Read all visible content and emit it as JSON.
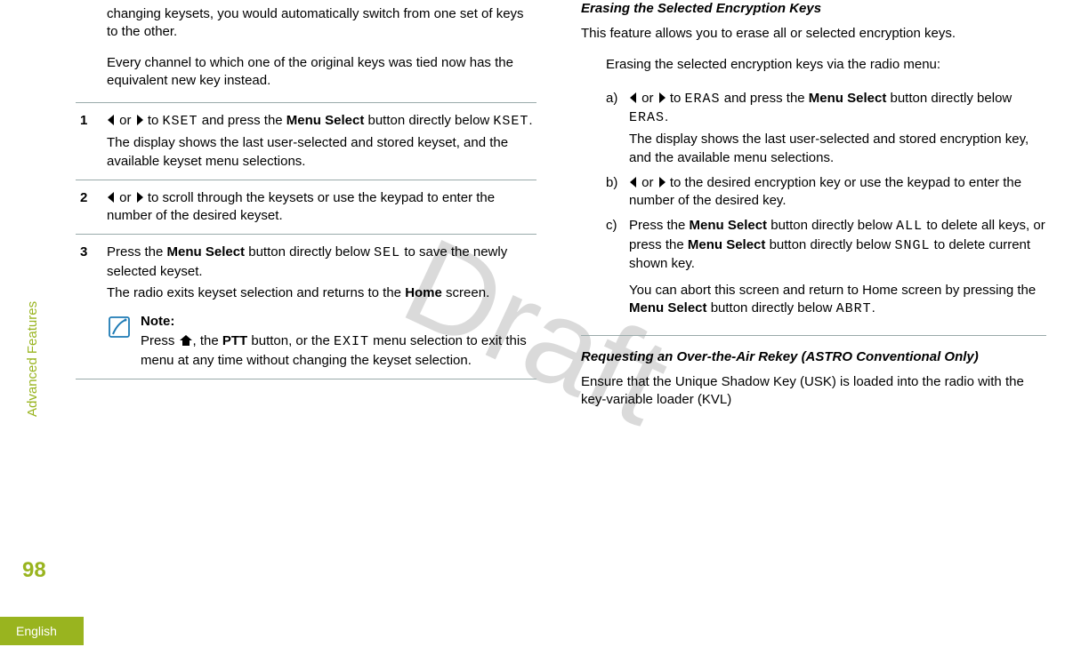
{
  "meta": {
    "section": "Advanced Features",
    "page_number": "98",
    "language": "English",
    "watermark": "Draft"
  },
  "col1": {
    "para1": "changing keysets, you would automatically switch from one set of keys to the other.",
    "para2": "Every channel to which one of the original keys was tied now has the equivalent new key instead.",
    "step1": {
      "num": "1",
      "pre": " or ",
      "mid1": " to ",
      "kset1": "KSET",
      "mid2": " and press the ",
      "bold1": "Menu Select",
      "mid3": " button directly below ",
      "kset2": "KSET",
      "end": ".",
      "line2": "The display shows the last user-selected and stored keyset, and the available keyset menu selections."
    },
    "step2": {
      "num": "2",
      "text": " to scroll through the keysets or use the keypad to enter the number of the desired keyset.",
      "pre": " or "
    },
    "step3": {
      "num": "3",
      "t1": "Press the ",
      "bold1": "Menu Select",
      "t2": " button directly below ",
      "sel": "SEL",
      "t3": " to save the newly selected keyset.",
      "line2a": "The radio exits keyset selection and returns to the ",
      "bold2": "Home",
      "line2b": " screen."
    },
    "note": {
      "title": "Note:",
      "t1": "Press ",
      "t2": ", the ",
      "bold1": "PTT",
      "t3": " button, or the ",
      "exit": "EXIT",
      "t4": " menu selection to exit this menu at any time without changing the keyset selection."
    }
  },
  "col2": {
    "heading1": "Erasing the Selected Encryption Keys",
    "para1": "This feature allows you to erase all or selected encryption keys.",
    "intro": "Erasing the selected encryption keys via the radio menu:",
    "a": {
      "letter": "a)",
      "pre": " or ",
      "mid1": " to ",
      "eras1": "ERAS",
      "mid2": " and press the ",
      "bold1": "Menu Select",
      "mid3": " button directly below ",
      "eras2": "ERAS",
      "end": ".",
      "line2": "The display shows the last user-selected and stored encryption key, and the available menu selections."
    },
    "b": {
      "letter": "b)",
      "pre": " or ",
      "text": " to the desired encryption key or use the keypad to enter the number of the desired key."
    },
    "c": {
      "letter": "c)",
      "t1": "Press the ",
      "bold1": "Menu Select",
      "t2": " button directly below ",
      "all": "ALL",
      "t3": " to delete all keys, or press the ",
      "bold2": "Menu Select",
      "t4": " button directly below ",
      "sngl": "SNGL",
      "t5": " to delete current shown key.",
      "p2a": "You can abort this screen and return to Home screen by pressing the ",
      "bold3": "Menu Select",
      "p2b": " button directly below ",
      "abrt": "ABRT",
      "p2c": "."
    },
    "heading2": "Requesting an Over-the-Air Rekey (ASTRO Conventional Only)",
    "para2": "Ensure that the Unique Shadow Key (USK) is loaded into the radio with the key-variable loader (KVL)"
  }
}
